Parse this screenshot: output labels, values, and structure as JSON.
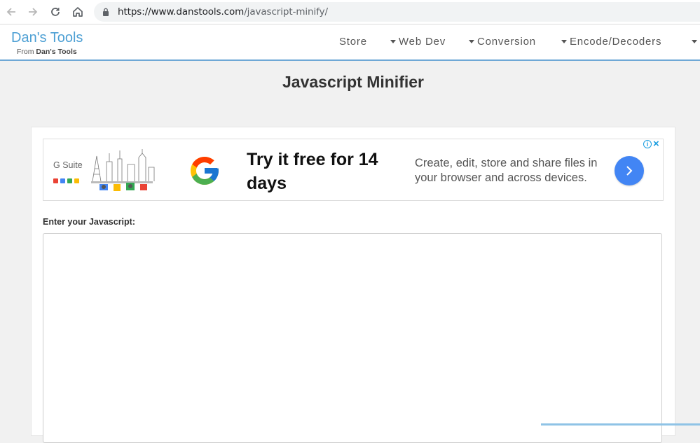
{
  "browser": {
    "url_host": "https://www.danstools.com",
    "url_path": "/javascript-minify/"
  },
  "site": {
    "brand": "Dan's Tools",
    "brand_sub_prefix": "From ",
    "brand_sub_name": "Dan's Tools",
    "nav": [
      {
        "label": "Store",
        "dropdown": false
      },
      {
        "label": "Web Dev",
        "dropdown": true
      },
      {
        "label": "Conversion",
        "dropdown": true
      },
      {
        "label": "Encode/Decoders",
        "dropdown": true
      }
    ]
  },
  "page": {
    "title": "Javascript Minifier",
    "input_label": "Enter your Javascript:",
    "input_value": ""
  },
  "ad": {
    "brand": "G Suite",
    "headline": "Try it free for 14 days",
    "body": "Create, edit, store and share files in your browser and across devices.",
    "colors": {
      "accent": "#4285f4",
      "info": "#1a9de0"
    }
  },
  "colors": {
    "brand": "#4ea0d4",
    "header_border": "#6fa8d6",
    "background": "#f1f1f1"
  }
}
